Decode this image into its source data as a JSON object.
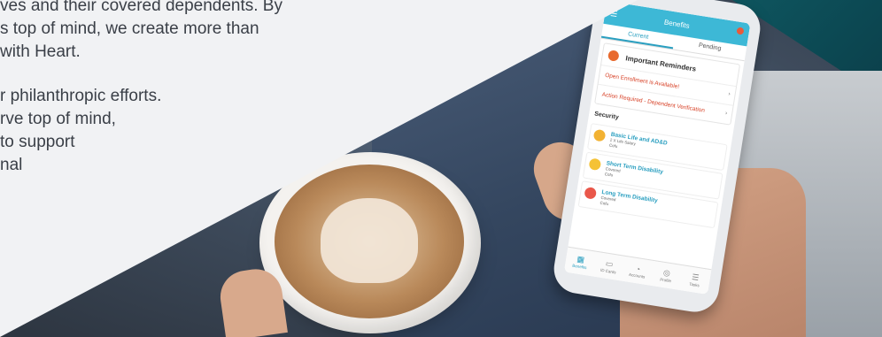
{
  "marketing_text": {
    "lines_top": [
      "ves and their covered dependents. By",
      "s top of mind, we create more than",
      "with Heart."
    ],
    "lines_bottom": [
      "r philanthropic efforts.",
      "rve top of mind,",
      "to support",
      "nal"
    ]
  },
  "phone_app": {
    "header_title": "Benefits",
    "tabs": [
      "Current",
      "Pending"
    ],
    "active_tab": "Current",
    "reminders": {
      "title": "Important Reminders",
      "items": [
        "Open Enrollment is Available!",
        "Action Required - Dependent Verification"
      ]
    },
    "section_title": "Security",
    "benefits": [
      {
        "name": "Basic Life and AD&D",
        "sub1": "2 X Life Salary",
        "sub2": "Cofu",
        "icon_color": "#f2b233"
      },
      {
        "name": "Short Term Disability",
        "sub1": "Covered",
        "sub2": "Cofu",
        "icon_color": "#f5c236"
      },
      {
        "name": "Long Term Disability",
        "sub1": "Covered",
        "sub2": "Cofu",
        "icon_color": "#e9574a"
      }
    ],
    "nav": [
      {
        "label": "Benefits",
        "icon": "benefits-icon",
        "glyph": "▦"
      },
      {
        "label": "ID Cards",
        "icon": "id-card-icon",
        "glyph": "▭"
      },
      {
        "label": "Accounts",
        "icon": "piggy-bank-icon",
        "glyph": "◔"
      },
      {
        "label": "Profile",
        "icon": "profile-icon",
        "glyph": "◎"
      },
      {
        "label": "Tasks",
        "icon": "tasks-icon",
        "glyph": "☰"
      }
    ],
    "colors": {
      "accent": "#3db8d6",
      "alert": "#d8452b"
    }
  }
}
